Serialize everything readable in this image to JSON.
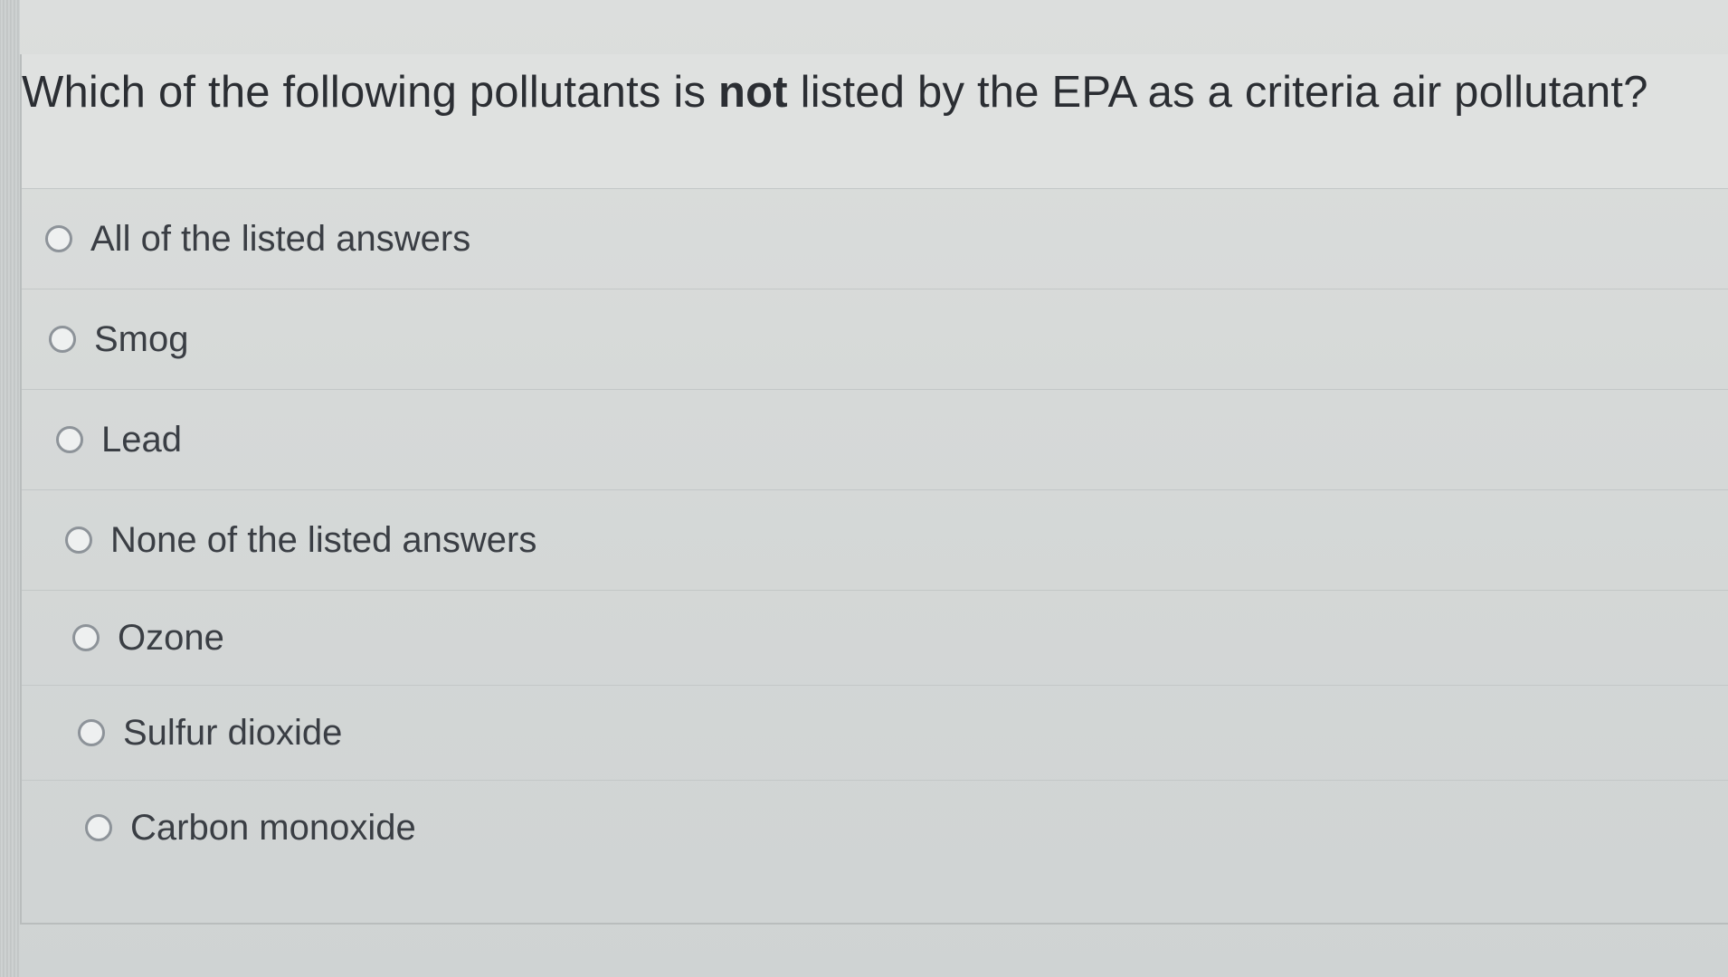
{
  "question": {
    "prefix": "Which of the following pollutants is ",
    "emphasis": "not",
    "suffix": " listed by the EPA as a criteria air pollutant?"
  },
  "options": [
    {
      "label": "All of the listed answers",
      "selected": false
    },
    {
      "label": "Smog",
      "selected": false
    },
    {
      "label": "Lead",
      "selected": false
    },
    {
      "label": "None of the listed answers",
      "selected": false
    },
    {
      "label": "Ozone",
      "selected": false
    },
    {
      "label": "Sulfur dioxide",
      "selected": false
    },
    {
      "label": "Carbon monoxide",
      "selected": false
    }
  ]
}
